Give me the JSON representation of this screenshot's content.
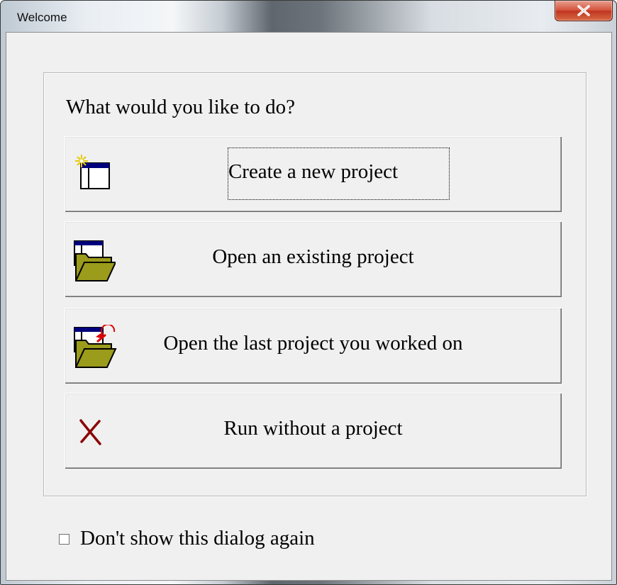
{
  "window": {
    "title": "Welcome"
  },
  "dialog": {
    "prompt": "What would you like to do?",
    "options": [
      {
        "label": "Create a new project",
        "icon": "new-project-icon",
        "focused": true
      },
      {
        "label": "Open an existing project",
        "icon": "open-folder-icon"
      },
      {
        "label": "Open the last project you worked on",
        "icon": "open-recent-folder-icon"
      },
      {
        "label": "Run without a project",
        "icon": "red-x-icon"
      }
    ],
    "checkbox": {
      "label": "Don't show this dialog again",
      "checked": false
    }
  },
  "colors": {
    "close_button": "#c8402a",
    "folder": "#8a8a1a",
    "dialog_bg": "#f0f0f0",
    "x_mark": "#8b0000"
  }
}
